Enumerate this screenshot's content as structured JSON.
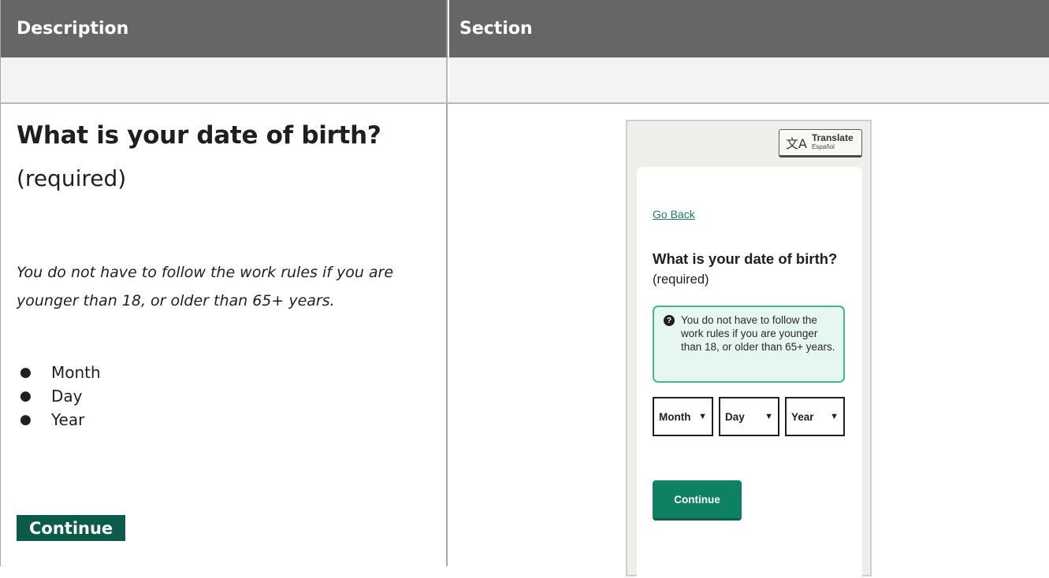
{
  "table": {
    "headers": [
      "Description",
      "Section"
    ]
  },
  "description": {
    "question": "What is your date of birth?",
    "required": "(required)",
    "hint": "You do not have to follow the work rules if you are younger than 18, or older than 65+ years.",
    "fields": [
      "Month",
      "Day",
      "Year"
    ],
    "continue_label": "Continue"
  },
  "mockup": {
    "translate_label": "Translate",
    "translate_sublabel": "Español",
    "go_back": "Go Back",
    "question": "What is your date of birth?",
    "required": "(required)",
    "hint": "You do not have to follow the work rules if you are younger than 18, or older than 65+ years.",
    "selects": [
      {
        "label": "Month"
      },
      {
        "label": "Day"
      },
      {
        "label": "Year"
      }
    ],
    "continue_label": "Continue"
  },
  "icons": {
    "translate": "translate-icon",
    "help": "question-circle-icon",
    "caret": "caret-down-icon",
    "bullet": "bullet-icon"
  },
  "colors": {
    "header_bg": "#666666",
    "brand_green": "#0e8063",
    "doc_button_green": "#0b5a4a",
    "hint_bg": "#e6f6f1",
    "hint_border": "#4bb392"
  }
}
